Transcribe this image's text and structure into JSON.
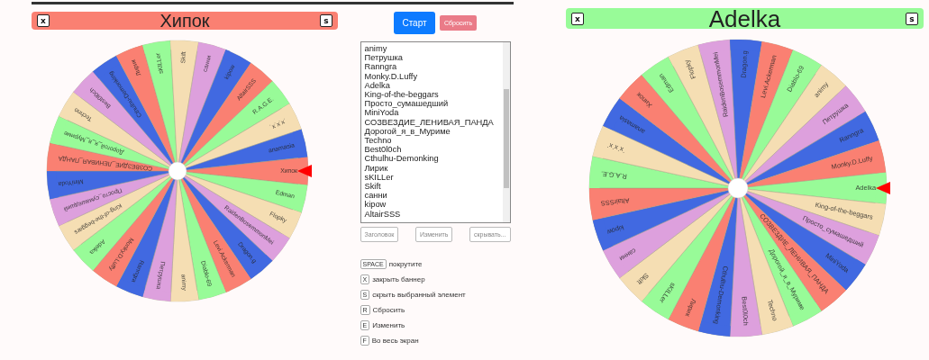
{
  "wheels": [
    {
      "title": "Хипок",
      "close_key": "x",
      "hide_key": "s",
      "segments": [
        {
          "label": "Хипок",
          "color": "#fa8072"
        },
        {
          "label": "Edman",
          "color": "#98fb98"
        },
        {
          "label": "Flopky",
          "color": "#f5deb3"
        },
        {
          "label": "RaidenBosemmonMei",
          "color": "#dda0dd"
        },
        {
          "label": "Dragon.g",
          "color": "#4169e1"
        },
        {
          "label": "Levi.Ackerman",
          "color": "#fa8072"
        },
        {
          "label": "Diablo-69",
          "color": "#98fb98"
        },
        {
          "label": "animy",
          "color": "#f5deb3"
        },
        {
          "label": "Петрушка",
          "color": "#dda0dd"
        },
        {
          "label": "Ranngra",
          "color": "#4169e1"
        },
        {
          "label": "Monky.D.Luffy",
          "color": "#fa8072"
        },
        {
          "label": "Adelka",
          "color": "#98fb98"
        },
        {
          "label": "King-of-the-beggars",
          "color": "#f5deb3"
        },
        {
          "label": "Просто_сумашедший",
          "color": "#dda0dd"
        },
        {
          "label": "MiniYoda",
          "color": "#4169e1"
        },
        {
          "label": "СОЗВЕЗДИЕ_ЛЕНИВАЯ_ПАНДА",
          "color": "#fa8072"
        },
        {
          "label": "Дорогой_я_в_Муриме",
          "color": "#98fb98"
        },
        {
          "label": "Techno",
          "color": "#f5deb3"
        },
        {
          "label": "Best0l0ch",
          "color": "#dda0dd"
        },
        {
          "label": "Cthulhu-Demonking",
          "color": "#4169e1"
        },
        {
          "label": "Лирик",
          "color": "#fa8072"
        },
        {
          "label": "sKILLer",
          "color": "#98fb98"
        },
        {
          "label": "Skift",
          "color": "#f5deb3"
        },
        {
          "label": "санни",
          "color": "#dda0dd"
        },
        {
          "label": "kipow",
          "color": "#4169e1"
        },
        {
          "label": "AltairSSS",
          "color": "#fa8072"
        },
        {
          "label": "R.A.G.E.",
          "color": "#98fb98"
        },
        {
          "label": "˙x˙x˙x˙",
          "color": "#f5deb3"
        },
        {
          "label": "anamasia",
          "color": "#4169e1"
        }
      ]
    },
    {
      "title": "Adelka",
      "close_key": "x",
      "hide_key": "s",
      "segments": [
        {
          "label": "Adelka",
          "color": "#98fb98"
        },
        {
          "label": "King-of-the-beggars",
          "color": "#f5deb3"
        },
        {
          "label": "Просто_сумашедший",
          "color": "#dda0dd"
        },
        {
          "label": "MiniYoda",
          "color": "#4169e1"
        },
        {
          "label": "СОЗВЕЗДИЕ_ЛЕНИВАЯ_ПАНДА",
          "color": "#fa8072"
        },
        {
          "label": "Дорогой_я_в_Муриме",
          "color": "#98fb98"
        },
        {
          "label": "Techno",
          "color": "#f5deb3"
        },
        {
          "label": "Best0l0ch",
          "color": "#dda0dd"
        },
        {
          "label": "Cthulhu-Demonking",
          "color": "#4169e1"
        },
        {
          "label": "Лирик",
          "color": "#fa8072"
        },
        {
          "label": "sKILLer",
          "color": "#98fb98"
        },
        {
          "label": "Skift",
          "color": "#f5deb3"
        },
        {
          "label": "санни",
          "color": "#dda0dd"
        },
        {
          "label": "kipow",
          "color": "#4169e1"
        },
        {
          "label": "AltairSSS",
          "color": "#fa8072"
        },
        {
          "label": "R.A.G.E.",
          "color": "#98fb98"
        },
        {
          "label": "˙x˙x˙x˙",
          "color": "#f5deb3"
        },
        {
          "label": "anamasia",
          "color": "#4169e1"
        },
        {
          "label": "Хипок",
          "color": "#fa8072"
        },
        {
          "label": "Edman",
          "color": "#98fb98"
        },
        {
          "label": "Flopky",
          "color": "#f5deb3"
        },
        {
          "label": "RaidenBosemmonMei",
          "color": "#dda0dd"
        },
        {
          "label": "Dragon.g",
          "color": "#4169e1"
        },
        {
          "label": "Levi.Ackerman",
          "color": "#fa8072"
        },
        {
          "label": "Diablo-69",
          "color": "#98fb98"
        },
        {
          "label": "animy",
          "color": "#f5deb3"
        },
        {
          "label": "Петрушка",
          "color": "#dda0dd"
        },
        {
          "label": "Ranngra",
          "color": "#4169e1"
        },
        {
          "label": "Monky.D.Luffy",
          "color": "#fa8072"
        }
      ]
    }
  ],
  "controls": {
    "start": "Старт",
    "reset": "Сбросить"
  },
  "names_list": [
    "animy",
    "Петрушка",
    "Ranngra",
    "Monky.D.Luffy",
    "Adelka",
    "King-of-the-beggars",
    "Просто_сумашедший",
    "MiniYoda",
    "СОЗВЕЗДИЕ_ЛЕНИВАЯ_ПАНДА",
    "Дорогой_я_в_Муриме",
    "Techno",
    "Best0l0ch",
    "Cthulhu-Demonking",
    "Лирик",
    "sKILLer",
    "Skift",
    "санни",
    "kipow",
    "AltairSSS"
  ],
  "list_buttons": [
    "Заголовок",
    "Изменить",
    "скрывать..."
  ],
  "shortcuts": [
    {
      "key": "SPACE",
      "text": "покрутите"
    },
    {
      "key": "X",
      "text": "закрыть баннер"
    },
    {
      "key": "S",
      "text": "скрыть выбранный элемент"
    },
    {
      "key": "R",
      "text": "Сбросить"
    },
    {
      "key": "E",
      "text": "Изменить"
    },
    {
      "key": "F",
      "text": "Во весь экран"
    }
  ]
}
